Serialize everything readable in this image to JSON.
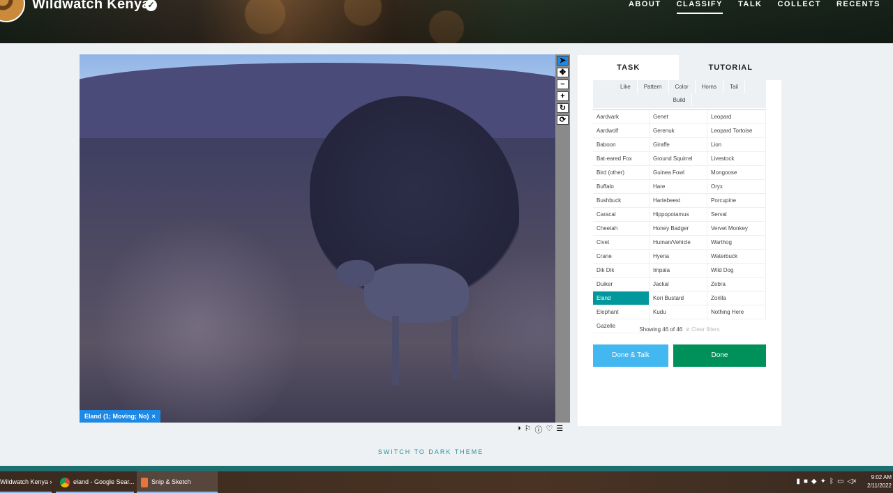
{
  "header": {
    "project_title": "Wildwatch Kenya",
    "nav": [
      "ABOUT",
      "CLASSIFY",
      "TALK",
      "COLLECT",
      "RECENTS"
    ],
    "active_nav": "CLASSIFY"
  },
  "viewer": {
    "annotation_label": "Eland (1; Moving; No)",
    "annotation_close": "×",
    "tools": [
      "pointer-icon",
      "move-icon",
      "zoom-out-icon",
      "zoom-in-icon",
      "rotate-icon",
      "reset-icon"
    ]
  },
  "task": {
    "tabs": [
      "TASK",
      "TUTORIAL"
    ],
    "filters_row1": [
      "Like",
      "Pattern",
      "Color",
      "Horns",
      "Tail"
    ],
    "filters_row2": [
      "Build"
    ],
    "species": [
      "Aardvark",
      "Genet",
      "Leopard",
      "Aardwolf",
      "Gerenuk",
      "Leopard Tortoise",
      "Baboon",
      "Giraffe",
      "Lion",
      "Bat-eared Fox",
      "Ground Squirrel",
      "Livestock",
      "Bird (other)",
      "Guinea Fowl",
      "Mongoose",
      "Buffalo",
      "Hare",
      "Oryx",
      "Bushbuck",
      "Hartebeest",
      "Porcupine",
      "Caracal",
      "Hippopotamus",
      "Serval",
      "Cheetah",
      "Honey Badger",
      "Vervet Monkey",
      "Civet",
      "Human/Vehicle",
      "Warthog",
      "Crane",
      "Hyena",
      "Waterbuck",
      "Dik Dik",
      "Impala",
      "Wild Dog",
      "Duiker",
      "Jackal",
      "Zebra",
      "Eland",
      "Kori Bustard",
      "Zorilla",
      "Elephant",
      "Kudu",
      "Nothing Here",
      "Gazelle"
    ],
    "selected": "Eland",
    "showing_text": "Showing 46 of 46",
    "clear_filters": "⊘ Clear filters",
    "done_talk_label": "Done & Talk",
    "done_label": "Done"
  },
  "switch_theme": "SWITCH TO DARK THEME",
  "taskbar": {
    "items": [
      "Wildwatch Kenya » ...",
      "eland - Google Sear...",
      "Snip & Sketch"
    ],
    "time": "9:02 AM",
    "date": "2/11/2022"
  }
}
